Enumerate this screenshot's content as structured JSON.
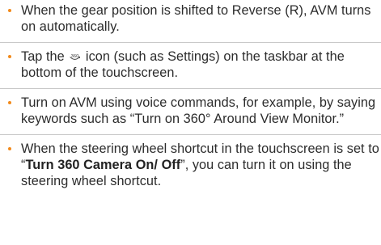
{
  "bullets": [
    {
      "text": "When the gear position is shifted to Reverse (R), AVM turns on automatically."
    },
    {
      "before": "Tap the ",
      "icon": "360-camera-icon",
      "after": " icon (such as Settings) on the taskbar at the bottom of the touchscreen."
    },
    {
      "text": "Turn on AVM using voice commands, for example, by saying keywords such as “Turn on 360° Around View Monitor.”"
    },
    {
      "before": "When the steering wheel shortcut in the touchscreen is set to “",
      "bold": "Turn 360 Camera On/ Off",
      "after": "”, you can turn it on using the steering wheel shortcut."
    }
  ],
  "colors": {
    "bullet": "#f28a1b",
    "text": "#2c2c2c",
    "divider": "#c9c9c9"
  }
}
